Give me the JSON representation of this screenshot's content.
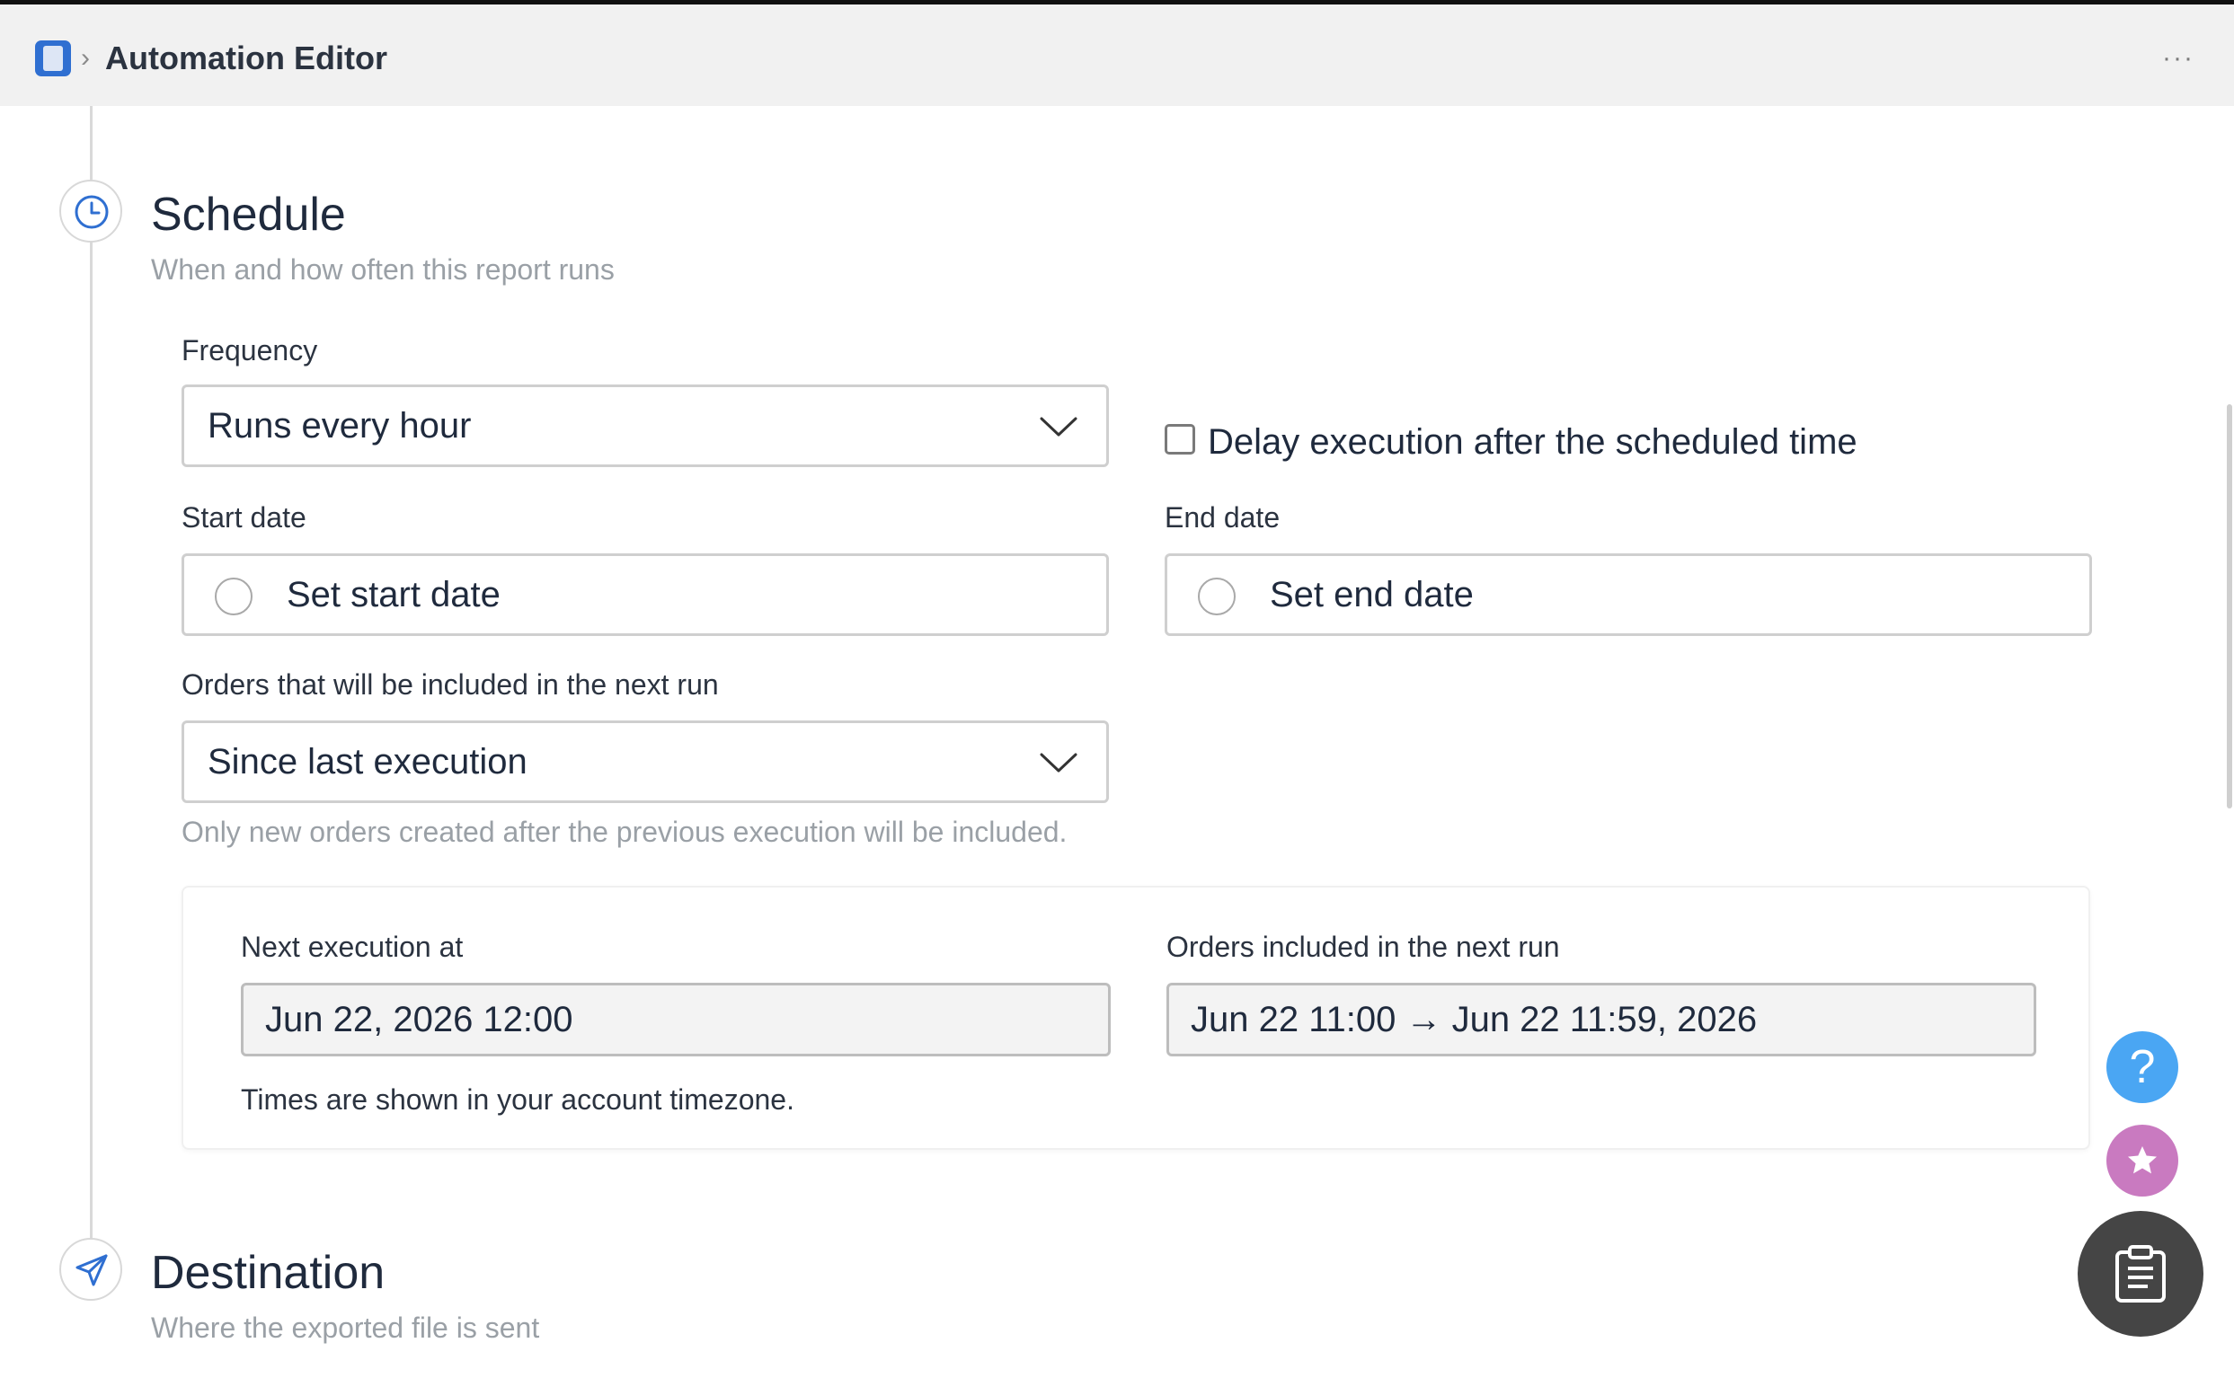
{
  "header": {
    "title": "Automation Editor",
    "separator": "›",
    "more_label": "···"
  },
  "schedule": {
    "title": "Schedule",
    "subtitle": "When and how often this report runs",
    "frequency_label": "Frequency",
    "frequency_value": "Runs every hour",
    "delay_label": "Delay execution after the scheduled time",
    "delay_checked": false,
    "start_date_label": "Start date",
    "start_date_placeholder": "Set start date",
    "end_date_label": "End date",
    "end_date_placeholder": "Set end date",
    "orders_label": "Orders that will be included in the next run",
    "orders_value": "Since last execution",
    "orders_hint": "Only new orders created after the previous execution will be included.",
    "summary": {
      "next_execution_label": "Next execution at",
      "next_execution_value": "Jun 22, 2026 12:00",
      "orders_included_label": "Orders included in the next run",
      "orders_included_value": "Jun 22 11:00 → Jun 22 11:59, 2026",
      "timezone_note": "Times are shown in your account timezone."
    }
  },
  "destination": {
    "title": "Destination",
    "subtitle": "Where the exported file is sent"
  },
  "fabs": {
    "help_label": "?"
  },
  "colors": {
    "accent": "#2f6fd1",
    "help_fab": "#4aa6f3",
    "star_fab": "#c97ac0",
    "clipboard_fab": "#454545"
  },
  "icons": {
    "schedule": "clock-icon",
    "destination": "paper-plane-icon",
    "dropdown": "chevron-down-icon",
    "help": "question-icon",
    "star": "star-icon",
    "clipboard": "clipboard-icon"
  }
}
